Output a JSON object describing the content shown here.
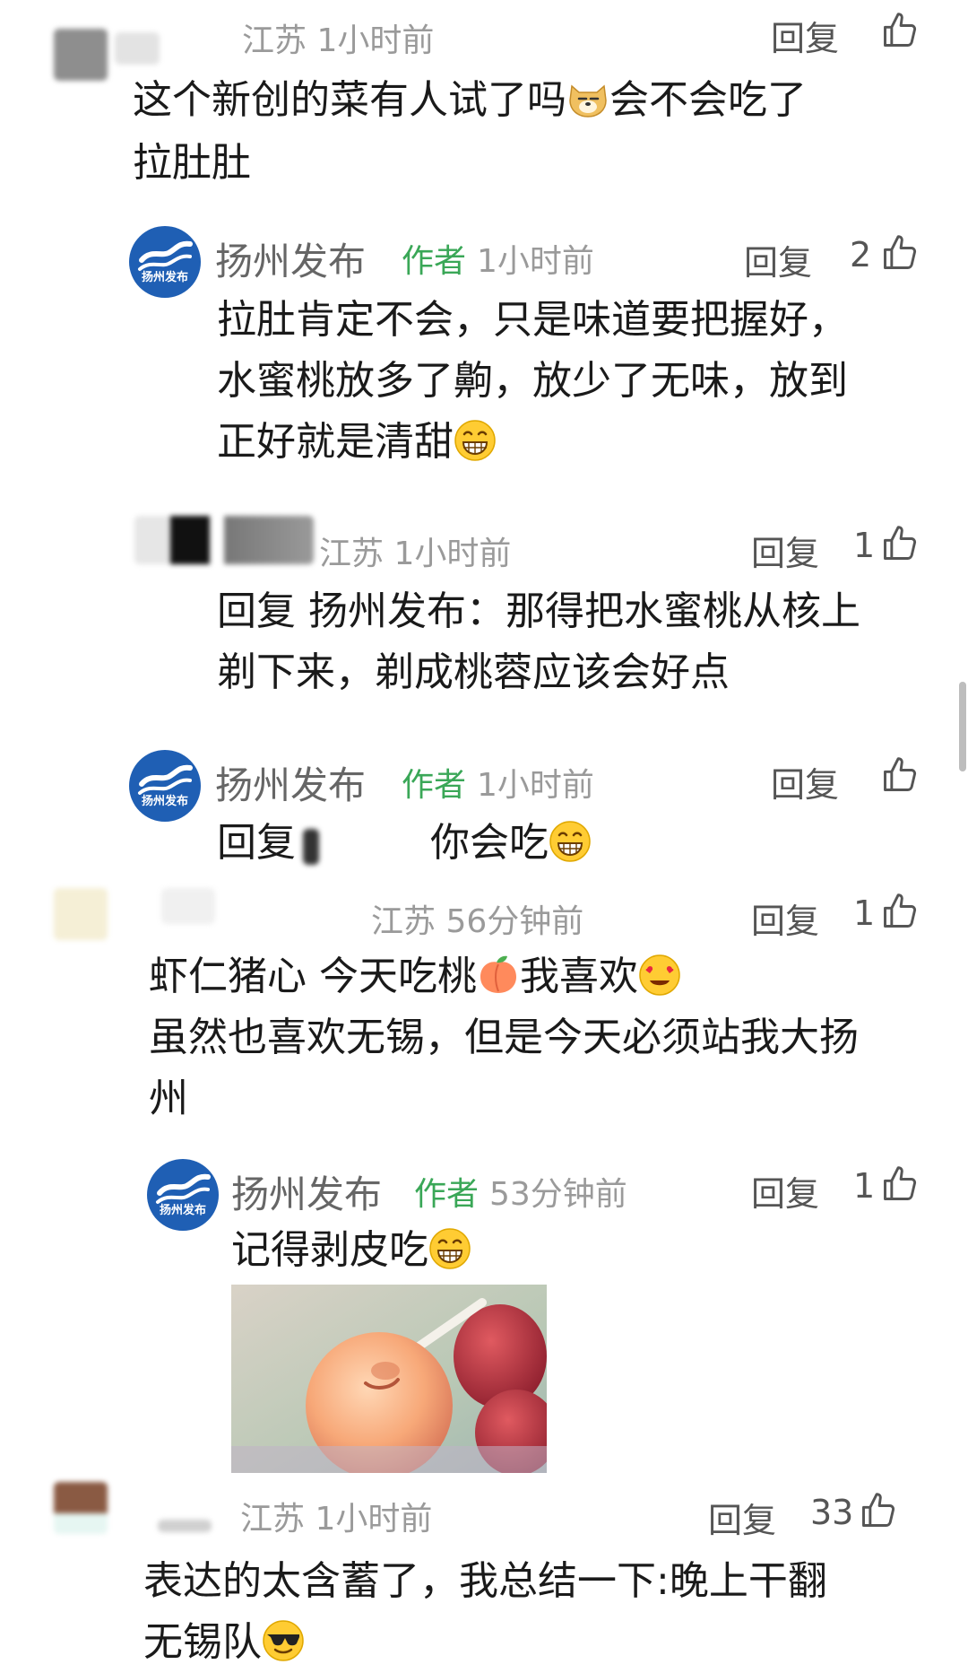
{
  "comments": [
    {
      "location_time": "江苏 1小时前",
      "text_lines": [
        "这个新创的菜有人试了吗",
        "会不会吃了",
        "拉肚肚"
      ],
      "reply_label": "回复"
    },
    {
      "name": "扬州发布",
      "author_tag": "作者",
      "time": "1小时前",
      "text_lines": [
        "拉肚肯定不会，只是味道要把握好，",
        "水蜜桃放多了齁，放少了无味，放到",
        "正好就是清甜"
      ],
      "reply_label": "回复",
      "likes": "2"
    },
    {
      "location_time": "江苏 1小时前",
      "text_lines": [
        "回复 扬州发布：那得把水蜜桃从核上",
        "剃下来，剃成桃蓉应该会好点"
      ],
      "reply_label": "回复",
      "likes": "1"
    },
    {
      "name": "扬州发布",
      "author_tag": "作者",
      "time": "1小时前",
      "text_prefix": "回复",
      "text_suffix": "你会吃",
      "reply_label": "回复"
    },
    {
      "location_time": "江苏 56分钟前",
      "text_lines": [
        "虾仁猪心 今天吃桃",
        "我喜欢",
        "虽然也喜欢无锡，但是今天必须站我大扬",
        "州"
      ],
      "reply_label": "回复",
      "likes": "1"
    },
    {
      "name": "扬州发布",
      "author_tag": "作者",
      "time": "53分钟前",
      "text_lines": [
        "记得剥皮吃"
      ],
      "reply_label": "回复",
      "likes": "1"
    },
    {
      "location_time": "江苏 1小时前",
      "text_lines": [
        "表达的太含蓄了，我总结一下:晚上干翻",
        "无锡队"
      ],
      "reply_label": "回复",
      "likes": "33"
    }
  ],
  "logo_text": "扬州发布",
  "icons": {
    "like": "thumbs-up-icon"
  },
  "colors": {
    "author": "#3aa757",
    "logo": "#1f5fb4"
  }
}
